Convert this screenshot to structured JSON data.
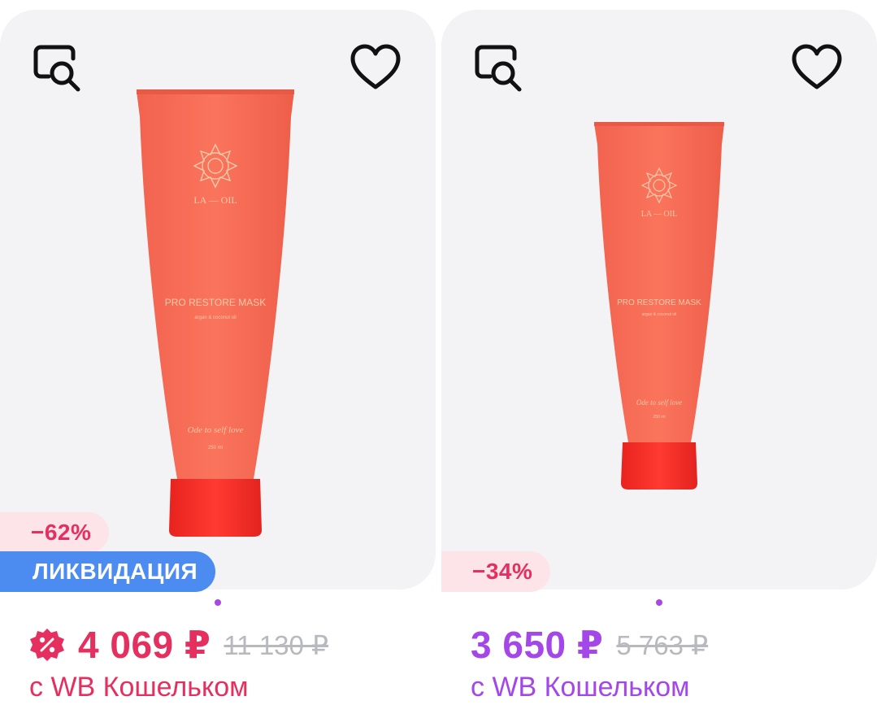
{
  "products": [
    {
      "discount": "−62%",
      "tag": "ЛИКВИДАЦИЯ",
      "price": "4 069 ₽",
      "old_price": "11 130 ₽",
      "wallet_note": "с WB Кошельком",
      "price_color": "#e5305f",
      "tube": {
        "brand": "LA — OIL",
        "product": "PRO RESTORE MASK",
        "note": "argan & coconut oil",
        "tagline": "Ode to self love",
        "volume": "250 ml"
      }
    },
    {
      "discount": "−34%",
      "price": "3 650 ₽",
      "old_price": "5 763 ₽",
      "wallet_note": "с WB Кошельком",
      "price_color": "#a347e8",
      "tube": {
        "brand": "LA — OIL",
        "product": "PRO RESTORE MASK",
        "note": "argan & coconut oil",
        "tagline": "Ode to self love",
        "volume": "250 ml"
      }
    }
  ],
  "icons": {
    "similar_search": "find-similar-icon",
    "favorite": "heart-outline-icon",
    "promo": "discount-badge-icon"
  },
  "colors": {
    "accent_red": "#e5305f",
    "accent_purple": "#a347e8",
    "liquidation_blue": "#4c8bf0",
    "card_bg": "#f3f3f5"
  }
}
